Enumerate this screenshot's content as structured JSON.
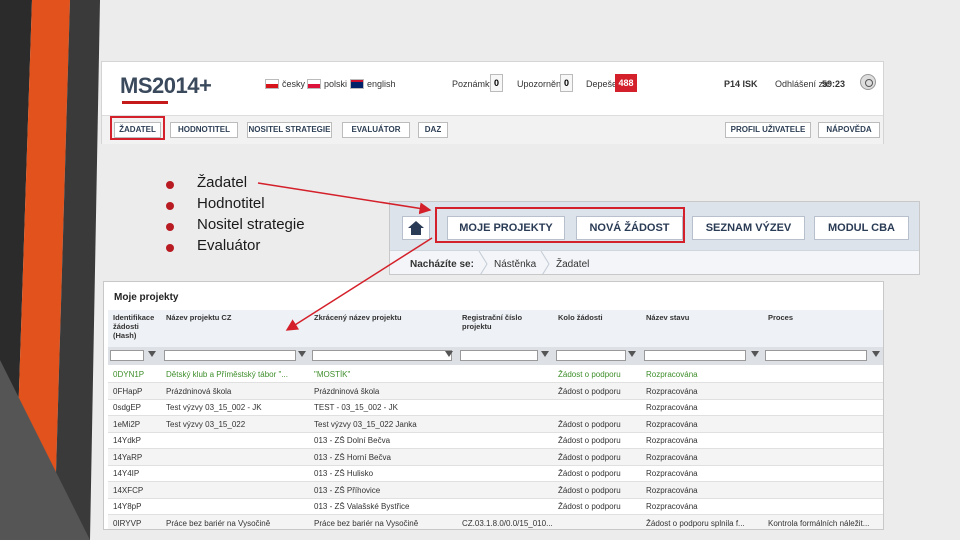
{
  "top_app": {
    "logo": "MS2014+",
    "languages": [
      {
        "label": "česky",
        "flag_colors": [
          "#ffffff",
          "#d7141a",
          "#11457e"
        ]
      },
      {
        "label": "polski",
        "flag_colors": [
          "#ffffff",
          "#dc143c"
        ]
      },
      {
        "label": "english",
        "flag_colors": [
          "#012169",
          "#c8102e"
        ]
      }
    ],
    "counters": [
      {
        "label": "Poznámky",
        "value": "0"
      },
      {
        "label": "Upozornění",
        "value": "0"
      },
      {
        "label": "Depeše",
        "value": "488"
      }
    ],
    "user": "P14 ISK",
    "logout_label": "Odhlášení za:",
    "logout_time": "59:23",
    "nav": [
      "ŽADATEL",
      "HODNOTITEL",
      "NOSITEL STRATEGIE",
      "EVALUÁTOR",
      "DAZ",
      "PROFIL UŽIVATELE",
      "NÁPOVĚDA"
    ]
  },
  "bullets": [
    "Žadatel",
    "Hodnotitel",
    "Nositel strategie",
    "Evaluátor"
  ],
  "mid_app": {
    "nav": [
      "MOJE PROJEKTY",
      "NOVÁ ŽÁDOST",
      "SEZNAM VÝZEV",
      "MODUL CBA"
    ],
    "breadcrumb_label": "Nacházíte se:",
    "breadcrumb": [
      "Nástěnka",
      "Žadatel"
    ]
  },
  "table": {
    "title": "Moje projekty",
    "headers": [
      "Identifikace žádosti (Hash)",
      "Název projektu CZ",
      "Zkrácený název projektu",
      "Registrační číslo projektu",
      "Kolo žádosti",
      "Název stavu",
      "Proces"
    ],
    "rows": [
      [
        "0DYN1P",
        "Dětský klub a Příměstský tábor \"...",
        "\"MOSTÍK\"",
        "",
        "Žádost o podporu",
        "Rozpracována",
        ""
      ],
      [
        "0FHapP",
        "Prázdninová škola",
        "Prázdninová škola",
        "",
        "Žádost o podporu",
        "Rozpracována",
        ""
      ],
      [
        "0sdgEP",
        "Test výzvy 03_15_002 - JK",
        "TEST - 03_15_002 - JK",
        "",
        "",
        "Rozpracována",
        ""
      ],
      [
        "1eMi2P",
        "Test výzvy 03_15_022",
        "Test výzvy 03_15_022 Janka",
        "",
        "Žádost o podporu",
        "Rozpracována",
        ""
      ],
      [
        "14YdkP",
        "",
        "013 - ZŠ Dolní Bečva",
        "",
        "Žádost o podporu",
        "Rozpracována",
        ""
      ],
      [
        "14YaRP",
        "",
        "013 - ZŠ Horní Bečva",
        "",
        "Žádost o podporu",
        "Rozpracována",
        ""
      ],
      [
        "14Y4IP",
        "",
        "013 - ZŠ Hulisko",
        "",
        "Žádost o podporu",
        "Rozpracována",
        ""
      ],
      [
        "14XFCP",
        "",
        "013 - ZŠ Příhovice",
        "",
        "Žádost o podporu",
        "Rozpracována",
        ""
      ],
      [
        "14Y8pP",
        "",
        "013 - ZŠ Valašské Bystřice",
        "",
        "Žádost o podporu",
        "Rozpracována",
        ""
      ],
      [
        "0IRYVP",
        "Práce bez bariér na Vysočině",
        "Práce bez bariér na Vysočině",
        "CZ.03.1.8.0/0.0/15_010...",
        "",
        "Žádost o podporu splnila f...",
        "Kontrola formálních náležit..."
      ]
    ]
  },
  "colors": {
    "accent_red": "#d4202a",
    "bullet_red": "#b81c22",
    "orange_stripe": "#e2521c"
  }
}
